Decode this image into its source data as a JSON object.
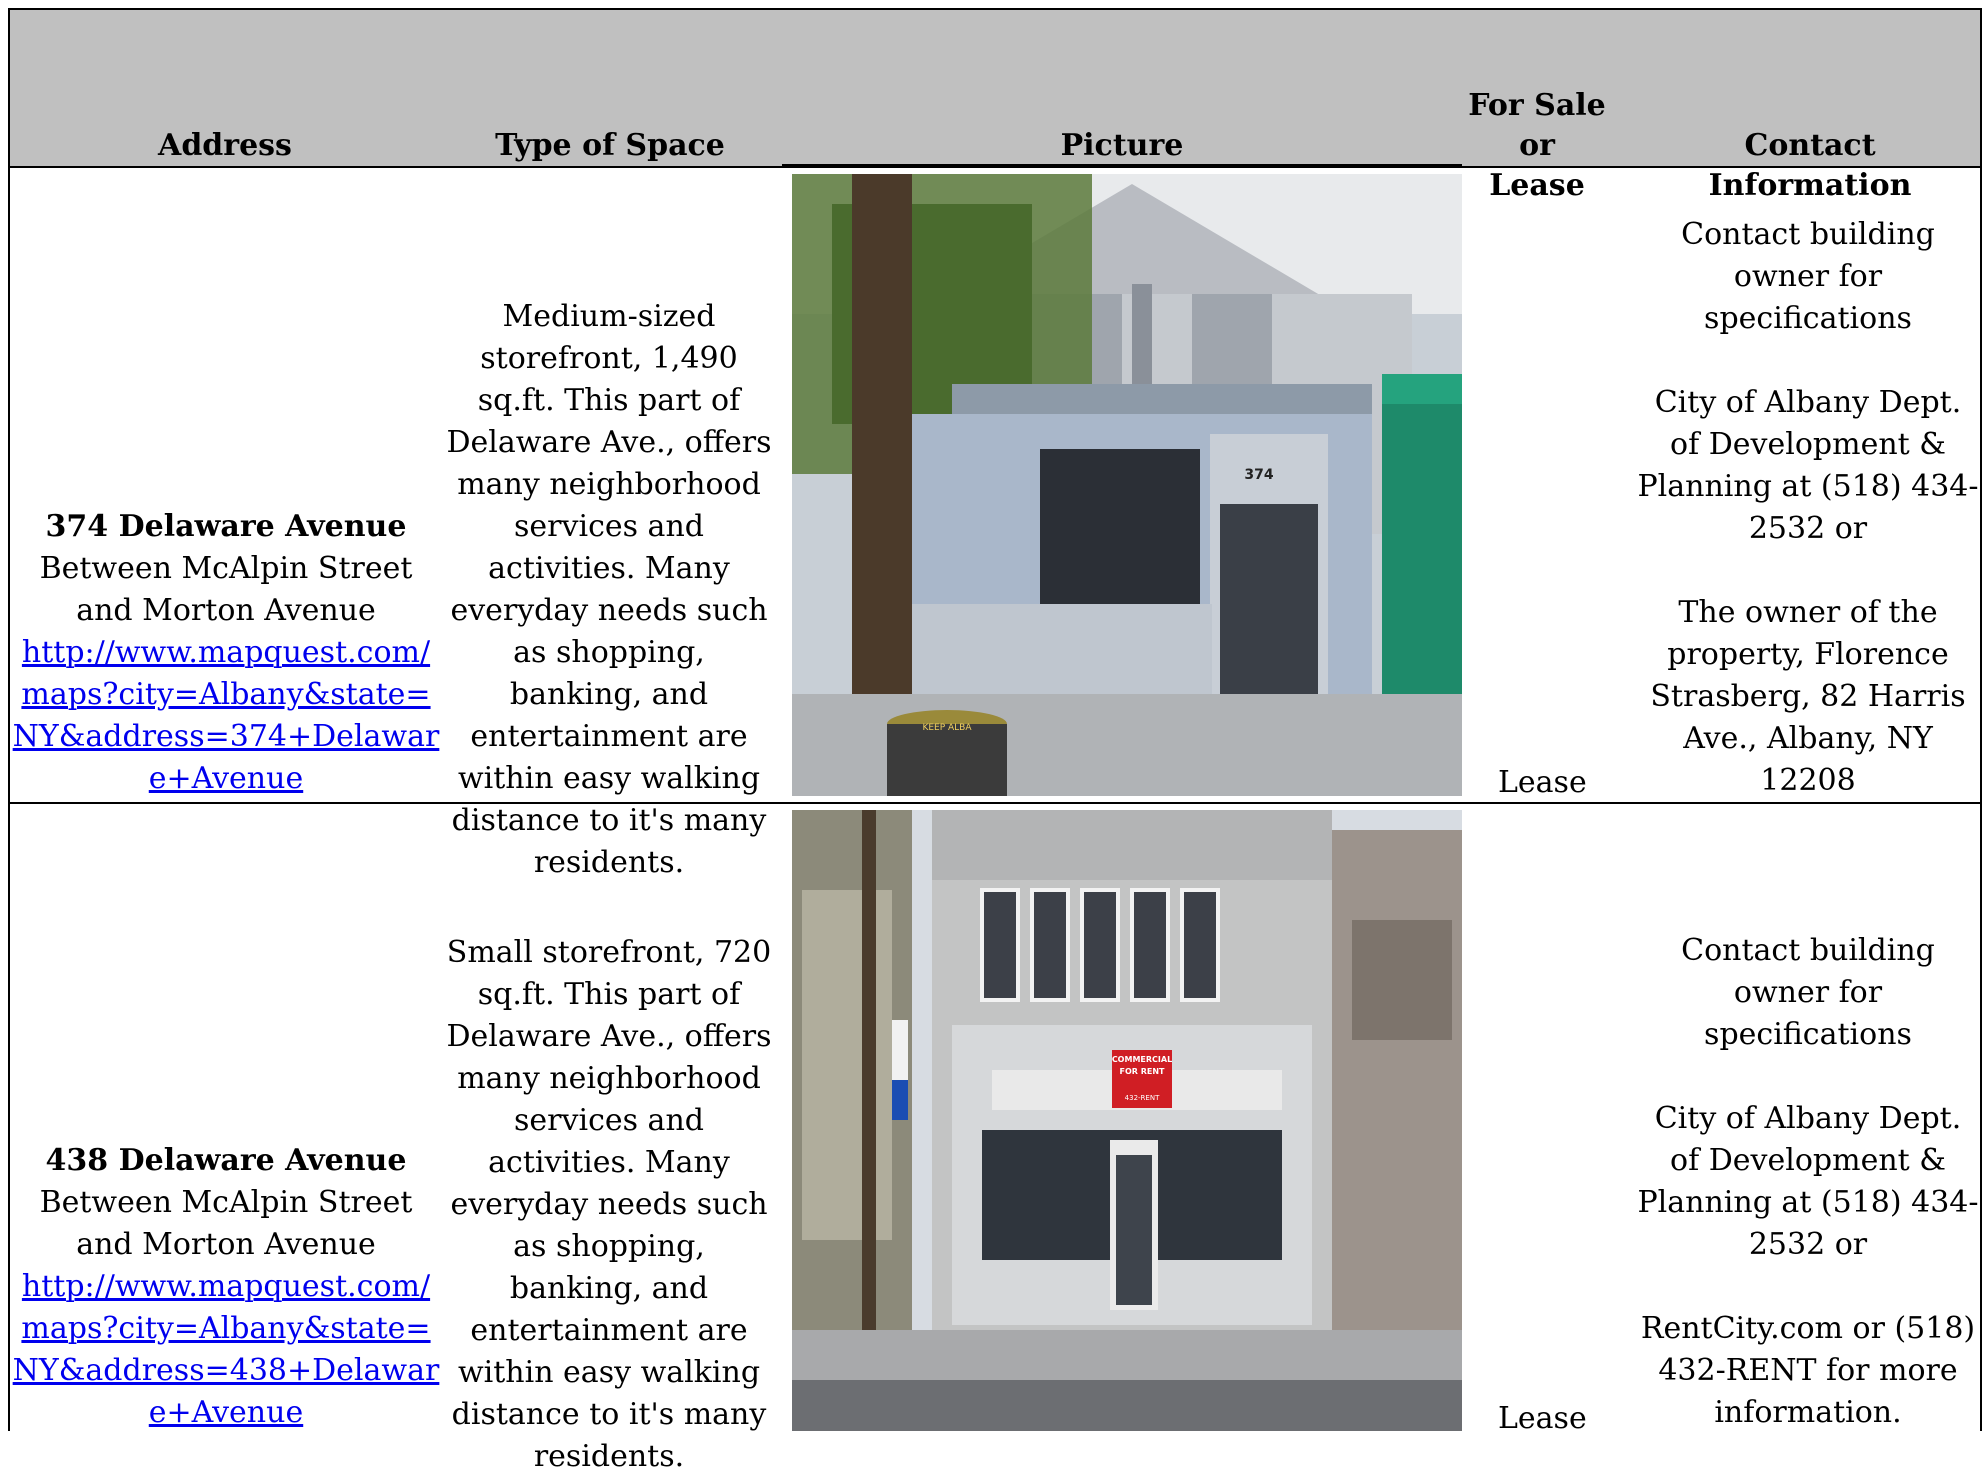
{
  "headers": {
    "address": "Address",
    "type": "Type of Space",
    "picture": "Picture",
    "sale_lease_1": "For Sale or",
    "sale_lease_2": "Lease",
    "contact": "Contact Information"
  },
  "rows": [
    {
      "address_title": "374 Delaware Avenue",
      "address_between": "Between McAlpin Street and Morton Avenue",
      "map_link": "http://www.mapquest.com/maps?city=Albany&state=NY&address=374+Delaware+Avenue",
      "description": "Medium-sized storefront, 1,490 sq.ft. This part of Delaware Ave., offers many neighborhood services and activities. Many everyday needs such as shopping, banking, and entertainment are within easy walking distance to it's many residents.",
      "sale_or_lease": "Lease",
      "contact_1": "Contact building owner for specifications",
      "contact_2": "City of Albany Dept. of Development & Planning at (518) 434-2532 or",
      "contact_3": "The owner of the property, Florence Strasberg, 82 Harris Ave., Albany, NY 12208",
      "photo_sign": "374",
      "trash_label": "KEEP ALBA"
    },
    {
      "address_title": "438 Delaware Avenue",
      "address_between": "Between McAlpin Street and Morton Avenue",
      "map_link": "http://www.mapquest.com/maps?city=Albany&state=NY&address=438+Delaware+Avenue",
      "description": "Small storefront, 720 sq.ft. This part of Delaware Ave., offers many neighborhood services and activities. Many everyday needs such as shopping, banking, and entertainment are within easy walking distance to it's many residents.",
      "sale_or_lease": "Lease",
      "contact_1": "Contact building owner for specifications",
      "contact_2": "City of Albany Dept. of Development & Planning at (518) 434-2532 or",
      "contact_3": "RentCity.com or (518) 432-RENT for more information.",
      "photo_sign_1": "COMMERCIAL",
      "photo_sign_2": "FOR RENT",
      "photo_sign_3": "432-RENT"
    }
  ]
}
